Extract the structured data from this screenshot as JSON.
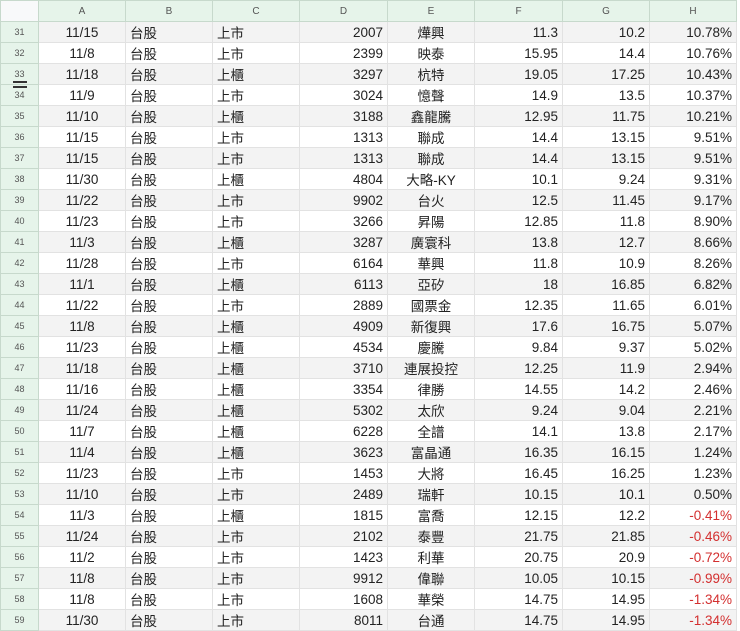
{
  "columns": [
    "A",
    "B",
    "C",
    "D",
    "E",
    "F",
    "G",
    "H"
  ],
  "rows": [
    [
      "31",
      "11/15",
      "台股",
      "上市",
      "2007",
      "燁興",
      "11.3",
      "10.2",
      "10.78%"
    ],
    [
      "32",
      "11/8",
      "台股",
      "上市",
      "2399",
      "映泰",
      "15.95",
      "14.4",
      "10.76%"
    ],
    [
      "33",
      "11/18",
      "台股",
      "上櫃",
      "3297",
      "杭特",
      "19.05",
      "17.25",
      "10.43%"
    ],
    [
      "34",
      "11/9",
      "台股",
      "上市",
      "3024",
      "憶聲",
      "14.9",
      "13.5",
      "10.37%"
    ],
    [
      "35",
      "11/10",
      "台股",
      "上櫃",
      "3188",
      "鑫龍騰",
      "12.95",
      "11.75",
      "10.21%"
    ],
    [
      "36",
      "11/15",
      "台股",
      "上市",
      "1313",
      "聯成",
      "14.4",
      "13.15",
      "9.51%"
    ],
    [
      "37",
      "11/15",
      "台股",
      "上市",
      "1313",
      "聯成",
      "14.4",
      "13.15",
      "9.51%"
    ],
    [
      "38",
      "11/30",
      "台股",
      "上櫃",
      "4804",
      "大略-KY",
      "10.1",
      "9.24",
      "9.31%"
    ],
    [
      "39",
      "11/22",
      "台股",
      "上市",
      "9902",
      "台火",
      "12.5",
      "11.45",
      "9.17%"
    ],
    [
      "40",
      "11/23",
      "台股",
      "上市",
      "3266",
      "昇陽",
      "12.85",
      "11.8",
      "8.90%"
    ],
    [
      "41",
      "11/3",
      "台股",
      "上櫃",
      "3287",
      "廣寰科",
      "13.8",
      "12.7",
      "8.66%"
    ],
    [
      "42",
      "11/28",
      "台股",
      "上市",
      "6164",
      "華興",
      "11.8",
      "10.9",
      "8.26%"
    ],
    [
      "43",
      "11/1",
      "台股",
      "上櫃",
      "6113",
      "亞矽",
      "18",
      "16.85",
      "6.82%"
    ],
    [
      "44",
      "11/22",
      "台股",
      "上市",
      "2889",
      "國票金",
      "12.35",
      "11.65",
      "6.01%"
    ],
    [
      "45",
      "11/8",
      "台股",
      "上櫃",
      "4909",
      "新復興",
      "17.6",
      "16.75",
      "5.07%"
    ],
    [
      "46",
      "11/23",
      "台股",
      "上櫃",
      "4534",
      "慶騰",
      "9.84",
      "9.37",
      "5.02%"
    ],
    [
      "47",
      "11/18",
      "台股",
      "上櫃",
      "3710",
      "連展投控",
      "12.25",
      "11.9",
      "2.94%"
    ],
    [
      "48",
      "11/16",
      "台股",
      "上櫃",
      "3354",
      "律勝",
      "14.55",
      "14.2",
      "2.46%"
    ],
    [
      "49",
      "11/24",
      "台股",
      "上櫃",
      "5302",
      "太欣",
      "9.24",
      "9.04",
      "2.21%"
    ],
    [
      "50",
      "11/7",
      "台股",
      "上櫃",
      "6228",
      "全譜",
      "14.1",
      "13.8",
      "2.17%"
    ],
    [
      "51",
      "11/4",
      "台股",
      "上櫃",
      "3623",
      "富晶通",
      "16.35",
      "16.15",
      "1.24%"
    ],
    [
      "52",
      "11/23",
      "台股",
      "上市",
      "1453",
      "大將",
      "16.45",
      "16.25",
      "1.23%"
    ],
    [
      "53",
      "11/10",
      "台股",
      "上市",
      "2489",
      "瑞軒",
      "10.15",
      "10.1",
      "0.50%"
    ],
    [
      "54",
      "11/3",
      "台股",
      "上櫃",
      "1815",
      "富喬",
      "12.15",
      "12.2",
      "-0.41%"
    ],
    [
      "55",
      "11/24",
      "台股",
      "上市",
      "2102",
      "泰豐",
      "21.75",
      "21.85",
      "-0.46%"
    ],
    [
      "56",
      "11/2",
      "台股",
      "上市",
      "1423",
      "利華",
      "20.75",
      "20.9",
      "-0.72%"
    ],
    [
      "57",
      "11/8",
      "台股",
      "上市",
      "9912",
      "偉聯",
      "10.05",
      "10.15",
      "-0.99%"
    ],
    [
      "58",
      "11/8",
      "台股",
      "上市",
      "1608",
      "華榮",
      "14.75",
      "14.95",
      "-1.34%"
    ],
    [
      "59",
      "11/30",
      "台股",
      "上市",
      "8011",
      "台通",
      "14.75",
      "14.95",
      "-1.34%"
    ]
  ],
  "colors": {
    "negative": "#d32f2f",
    "header_bg": "#e6f4ea"
  }
}
